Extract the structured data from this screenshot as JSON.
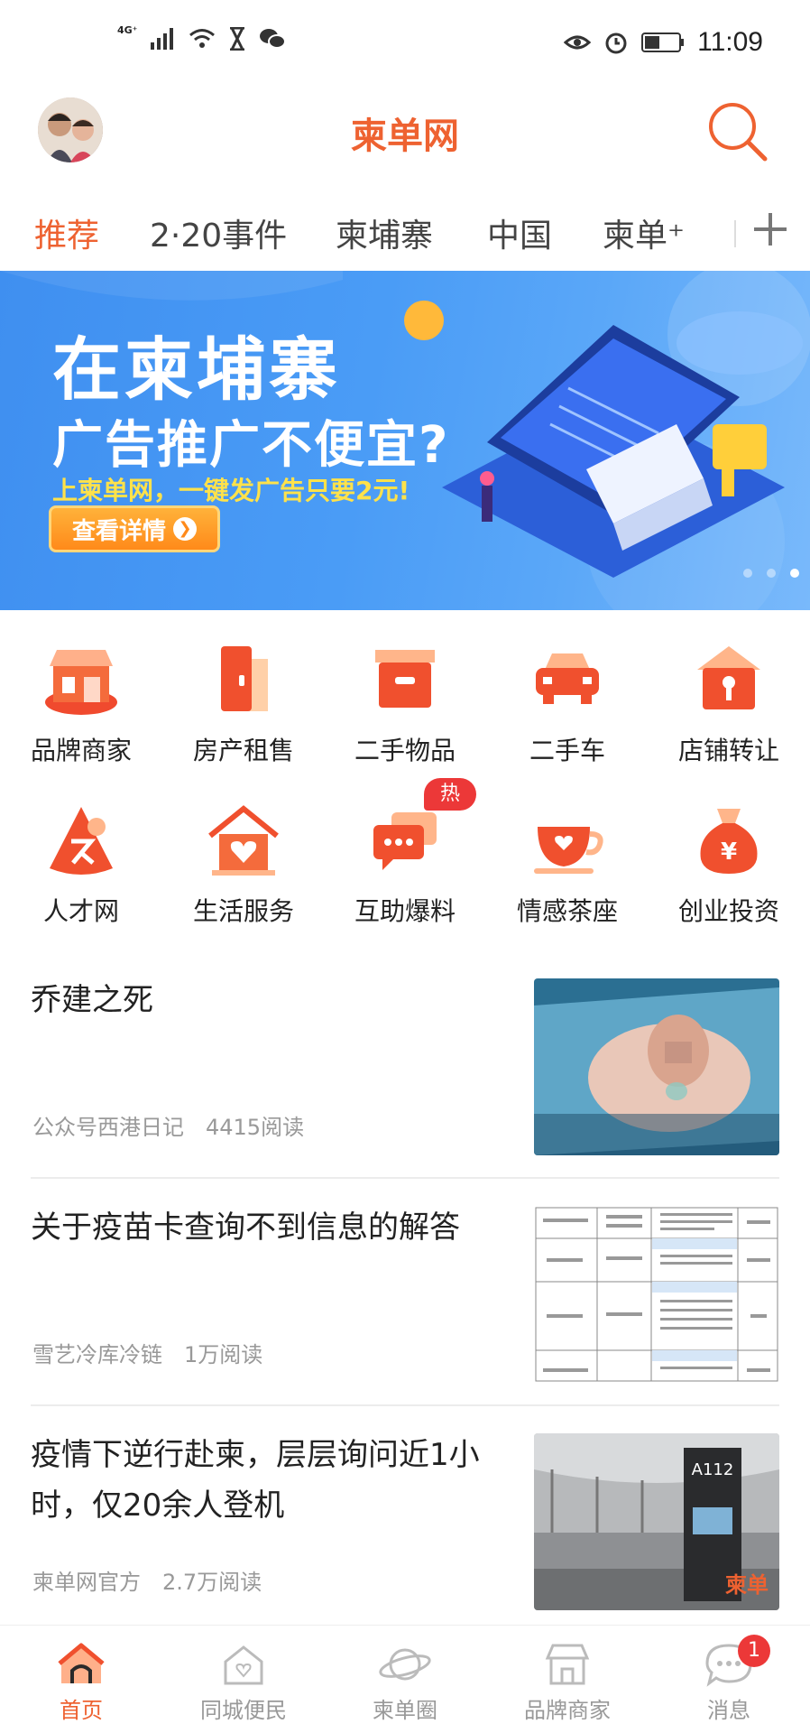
{
  "status_bar": {
    "network": "4G⁺",
    "time": "11:09"
  },
  "header": {
    "title": "柬单网"
  },
  "tabs": [
    {
      "label": "推荐",
      "active": true
    },
    {
      "label": "2·20事件"
    },
    {
      "label": "柬埔寨"
    },
    {
      "label": "中国"
    },
    {
      "label": "柬单⁺"
    }
  ],
  "banner": {
    "line1": "在柬埔寨",
    "line2": "广告推广不便宜?",
    "line3": "上柬单网，一键发广告只要2元!",
    "button": "查看详情",
    "page_count": 3,
    "current_page": 3
  },
  "categories": [
    {
      "label": "品牌商家",
      "icon": "shop-icon"
    },
    {
      "label": "房产租售",
      "icon": "door-icon"
    },
    {
      "label": "二手物品",
      "icon": "box-icon"
    },
    {
      "label": "二手车",
      "icon": "car-icon"
    },
    {
      "label": "店铺转让",
      "icon": "store-key-icon"
    },
    {
      "label": "人才网",
      "icon": "talent-icon"
    },
    {
      "label": "生活服务",
      "icon": "house-heart-icon"
    },
    {
      "label": "互助爆料",
      "icon": "chat-icon"
    },
    {
      "label": "情感茶座",
      "icon": "teacup-icon"
    },
    {
      "label": "创业投资",
      "icon": "money-bag-icon"
    }
  ],
  "hot_badge": "热",
  "articles": [
    {
      "title": "乔建之死",
      "source": "公众号西港日记",
      "reads": "4415阅读"
    },
    {
      "title": "关于疫苗卡查询不到信息的解答",
      "source": "雪艺冷库冷链",
      "reads": "1万阅读"
    },
    {
      "title": "疫情下逆行赴柬，层层询问近1小时，仅20余人登机",
      "source": "柬单网官方",
      "reads": "2.7万阅读"
    }
  ],
  "thumb3_sign": "A112",
  "thumb3_watermark": "柬单",
  "bottom_nav": [
    {
      "label": "首页",
      "active": true
    },
    {
      "label": "同城便民"
    },
    {
      "label": "柬单圈"
    },
    {
      "label": "品牌商家"
    },
    {
      "label": "消息",
      "badge": "1"
    }
  ],
  "colors": {
    "accent": "#ee6231",
    "badge": "#ec3838",
    "banner_blue": "#4a9cf6"
  }
}
